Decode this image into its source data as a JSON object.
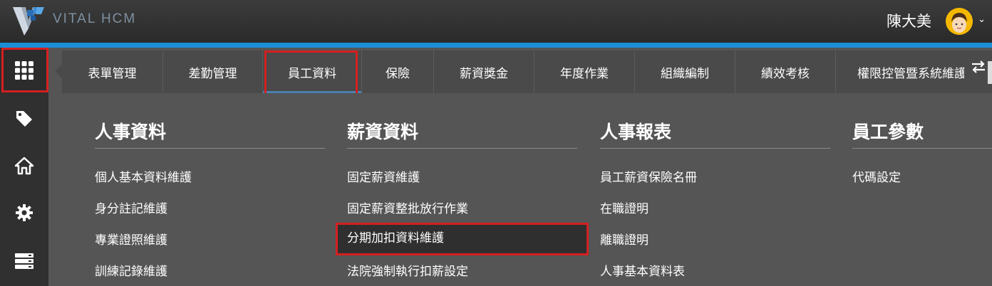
{
  "app": {
    "brand": "VITAL HCM",
    "user_name": "陳大美",
    "accent": "#1b8fd6",
    "highlight": "#d42020"
  },
  "sidebar": {
    "items": [
      {
        "icon": "grid-icon",
        "active": true
      },
      {
        "icon": "tag-icon"
      },
      {
        "icon": "home-icon"
      },
      {
        "icon": "gear-icon"
      },
      {
        "icon": "server-icon"
      }
    ]
  },
  "tabs": [
    {
      "label": "表單管理"
    },
    {
      "label": "差勤管理"
    },
    {
      "label": "員工資料",
      "active": true
    },
    {
      "label": "保險"
    },
    {
      "label": "薪資獎金"
    },
    {
      "label": "年度作業"
    },
    {
      "label": "組織編制"
    },
    {
      "label": "績效考核"
    },
    {
      "label": "權限控管暨系統維護"
    }
  ],
  "menu": {
    "columns": [
      {
        "title": "人事資料",
        "items": [
          "個人基本資料維護",
          "身分註記維護",
          "專業證照維護",
          "訓練記錄維護"
        ]
      },
      {
        "title": "薪資資料",
        "items": [
          "固定薪資維護",
          "固定薪資整批放行作業",
          "分期加扣資料維護",
          "法院強制執行扣薪設定"
        ]
      },
      {
        "title": "人事報表",
        "items": [
          "員工薪資保險名冊",
          "在職證明",
          "離職證明",
          "人事基本資料表"
        ]
      },
      {
        "title": "員工參數",
        "items": [
          "代碼設定"
        ]
      }
    ]
  }
}
